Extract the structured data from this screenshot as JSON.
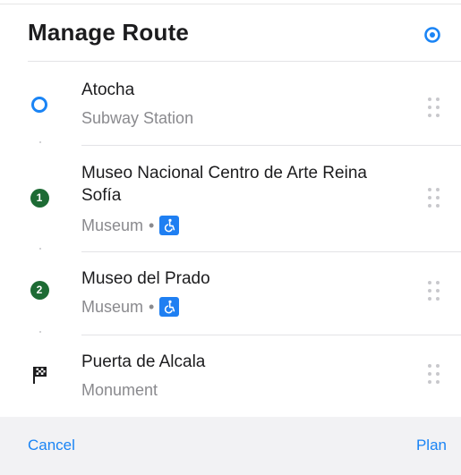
{
  "header": {
    "title": "Manage Route",
    "locate_icon": "location-target-icon"
  },
  "stops": [
    {
      "marker": "origin",
      "marker_label": "",
      "name": "Atocha",
      "category": "Subway Station",
      "accessible": false
    },
    {
      "marker": "numbered",
      "marker_label": "1",
      "name": "Museo Nacional Centro de Arte Reina Sofía",
      "category": "Museum",
      "separator": "•",
      "accessible": true
    },
    {
      "marker": "numbered",
      "marker_label": "2",
      "name": "Museo del Prado",
      "category": "Museum",
      "separator": "•",
      "accessible": true
    },
    {
      "marker": "destination",
      "marker_label": "",
      "name": "Puerta de Alcala",
      "category": "Monument",
      "accessible": false
    }
  ],
  "footer": {
    "cancel_label": "Cancel",
    "plan_label": "Plan"
  },
  "colors": {
    "accent": "#1a84f5",
    "stop_marker": "#1d6b34",
    "accessibility_badge": "#1f7ff2",
    "footer_bg": "#f2f2f4"
  }
}
